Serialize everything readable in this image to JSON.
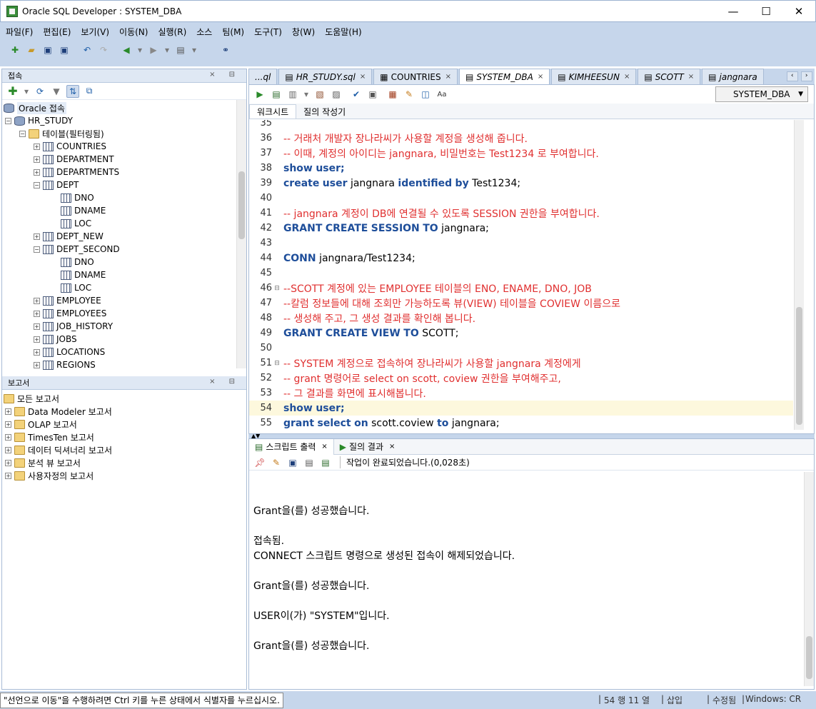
{
  "window": {
    "title": "Oracle SQL Developer : SYSTEM_DBA"
  },
  "menu": [
    "파일(F)",
    "편집(E)",
    "보기(V)",
    "이동(N)",
    "실행(R)",
    "소스",
    "팀(M)",
    "도구(T)",
    "창(W)",
    "도움말(H)"
  ],
  "connections": {
    "panel_title": "접속",
    "root": "Oracle 접속",
    "conn": "HR_STUDY",
    "tables_folder": "테이블(필터링됨)",
    "tables": [
      "COUNTRIES",
      "DEPARTMENT",
      "DEPARTMENTS",
      "DEPT",
      "DNO",
      "DNAME",
      "LOC",
      "DEPT_NEW",
      "DEPT_SECOND",
      "DNO",
      "DNAME",
      "LOC",
      "EMPLOYEE",
      "EMPLOYEES",
      "JOB_HISTORY",
      "JOBS",
      "LOCATIONS",
      "REGIONS"
    ]
  },
  "reports": {
    "panel_title": "보고서",
    "items": [
      "모든 보고서",
      "Data Modeler 보고서",
      "OLAP 보고서",
      "TimesTen 보고서",
      "데이터 딕셔너리 보고서",
      "분석 뷰 보고서",
      "사용자정의 보고서"
    ]
  },
  "tabs": [
    "...ql",
    "HR_STUDY.sql",
    "COUNTRIES",
    "SYSTEM_DBA",
    "KIMHEESUN",
    "SCOTT",
    "jangnara"
  ],
  "editor": {
    "connection": "SYSTEM_DBA",
    "subtabs": [
      "워크시트",
      "질의 작성기"
    ],
    "lines": [
      {
        "n": "35",
        "t": ""
      },
      {
        "n": "36",
        "t": "-- 거래처 개발자 장나라씨가 사용할 계정을 생성해 줍니다."
      },
      {
        "n": "37",
        "t": "-- 이때, 계정의 아이디는 jangnara, 비밀번호는 Test1234 로 부여합니다."
      },
      {
        "n": "38",
        "t": "show user;"
      },
      {
        "n": "39",
        "t": "create user jangnara identified by Test1234;"
      },
      {
        "n": "40",
        "t": ""
      },
      {
        "n": "41",
        "t": "-- jangnara 계정이 DB에 연결될 수 있도록 SESSION 권한을 부여합니다."
      },
      {
        "n": "42",
        "t": "GRANT CREATE SESSION TO jangnara;"
      },
      {
        "n": "43",
        "t": ""
      },
      {
        "n": "44",
        "t": "CONN jangnara/Test1234;"
      },
      {
        "n": "45",
        "t": ""
      },
      {
        "n": "46",
        "t": "--SCOTT 계정에 있는 EMPLOYEE 테이블의 ENO, ENAME, DNO, JOB"
      },
      {
        "n": "47",
        "t": "--칼럼 정보들에 대해 조회만 가능하도록 뷰(VIEW) 테이블을 COVIEW 이름으로"
      },
      {
        "n": "48",
        "t": "-- 생성해 주고, 그 생성 결과를 확인해 봅니다."
      },
      {
        "n": "49",
        "t": "GRANT CREATE VIEW TO SCOTT;"
      },
      {
        "n": "50",
        "t": ""
      },
      {
        "n": "51",
        "t": "-- SYSTEM 계정으로 접속하여 장나라씨가 사용할 jangnara 계정에게"
      },
      {
        "n": "52",
        "t": "-- grant 명령어로 select on scott, coview 권한을 부여해주고,"
      },
      {
        "n": "53",
        "t": "-- 그 결과를 화면에 표시해봅니다."
      },
      {
        "n": "54",
        "t": "show user;"
      },
      {
        "n": "55",
        "t": "grant select on scott.coview to jangnara;"
      }
    ]
  },
  "output": {
    "tabs": [
      "스크립트 출력",
      "질의 결과"
    ],
    "status": "작업이 완료되었습니다.(0,028초)",
    "lines": [
      "",
      "Grant을(를) 성공했습니다.",
      "",
      "접속됨.",
      "CONNECT 스크립트 명령으로 생성된 접속이 해제되었습니다.",
      "",
      "Grant을(를) 성공했습니다.",
      "",
      "USER이(가) \"SYSTEM\"입니다.",
      "",
      "Grant을(를) 성공했습니다."
    ]
  },
  "statusbar": {
    "message": "\"선언으로 이동\"을 수행하려면 Ctrl 키를 누른 상태에서 식별자를 누르십시오.",
    "position": "54 행 11 열",
    "mode": "삽입",
    "modified": "수정됨",
    "eol": "Windows: CR"
  }
}
